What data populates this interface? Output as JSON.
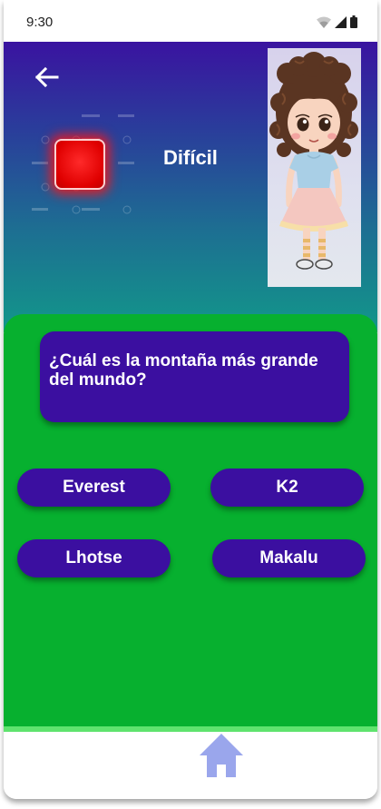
{
  "status_bar": {
    "time": "9:30",
    "icons": [
      "wifi-icon",
      "signal-icon",
      "battery-icon"
    ]
  },
  "header": {
    "back_icon": "arrow-left-icon",
    "level_label": "Difícil",
    "level_color": "#e00000",
    "avatar": "cartoon-girl-avatar"
  },
  "quiz": {
    "question": "¿Cuál es la montaña más grande del mundo?",
    "answers": [
      "Everest",
      "K2",
      "Lhotse",
      "Makalu"
    ]
  },
  "bottom_nav": {
    "home_icon": "home-icon"
  },
  "colors": {
    "header_top": "#3a13a0",
    "header_bottom": "#12978a",
    "panel": "#07b02f",
    "button": "#3b0fa0",
    "divider": "#5fe36e",
    "home_icon": "#9aa6ec"
  }
}
